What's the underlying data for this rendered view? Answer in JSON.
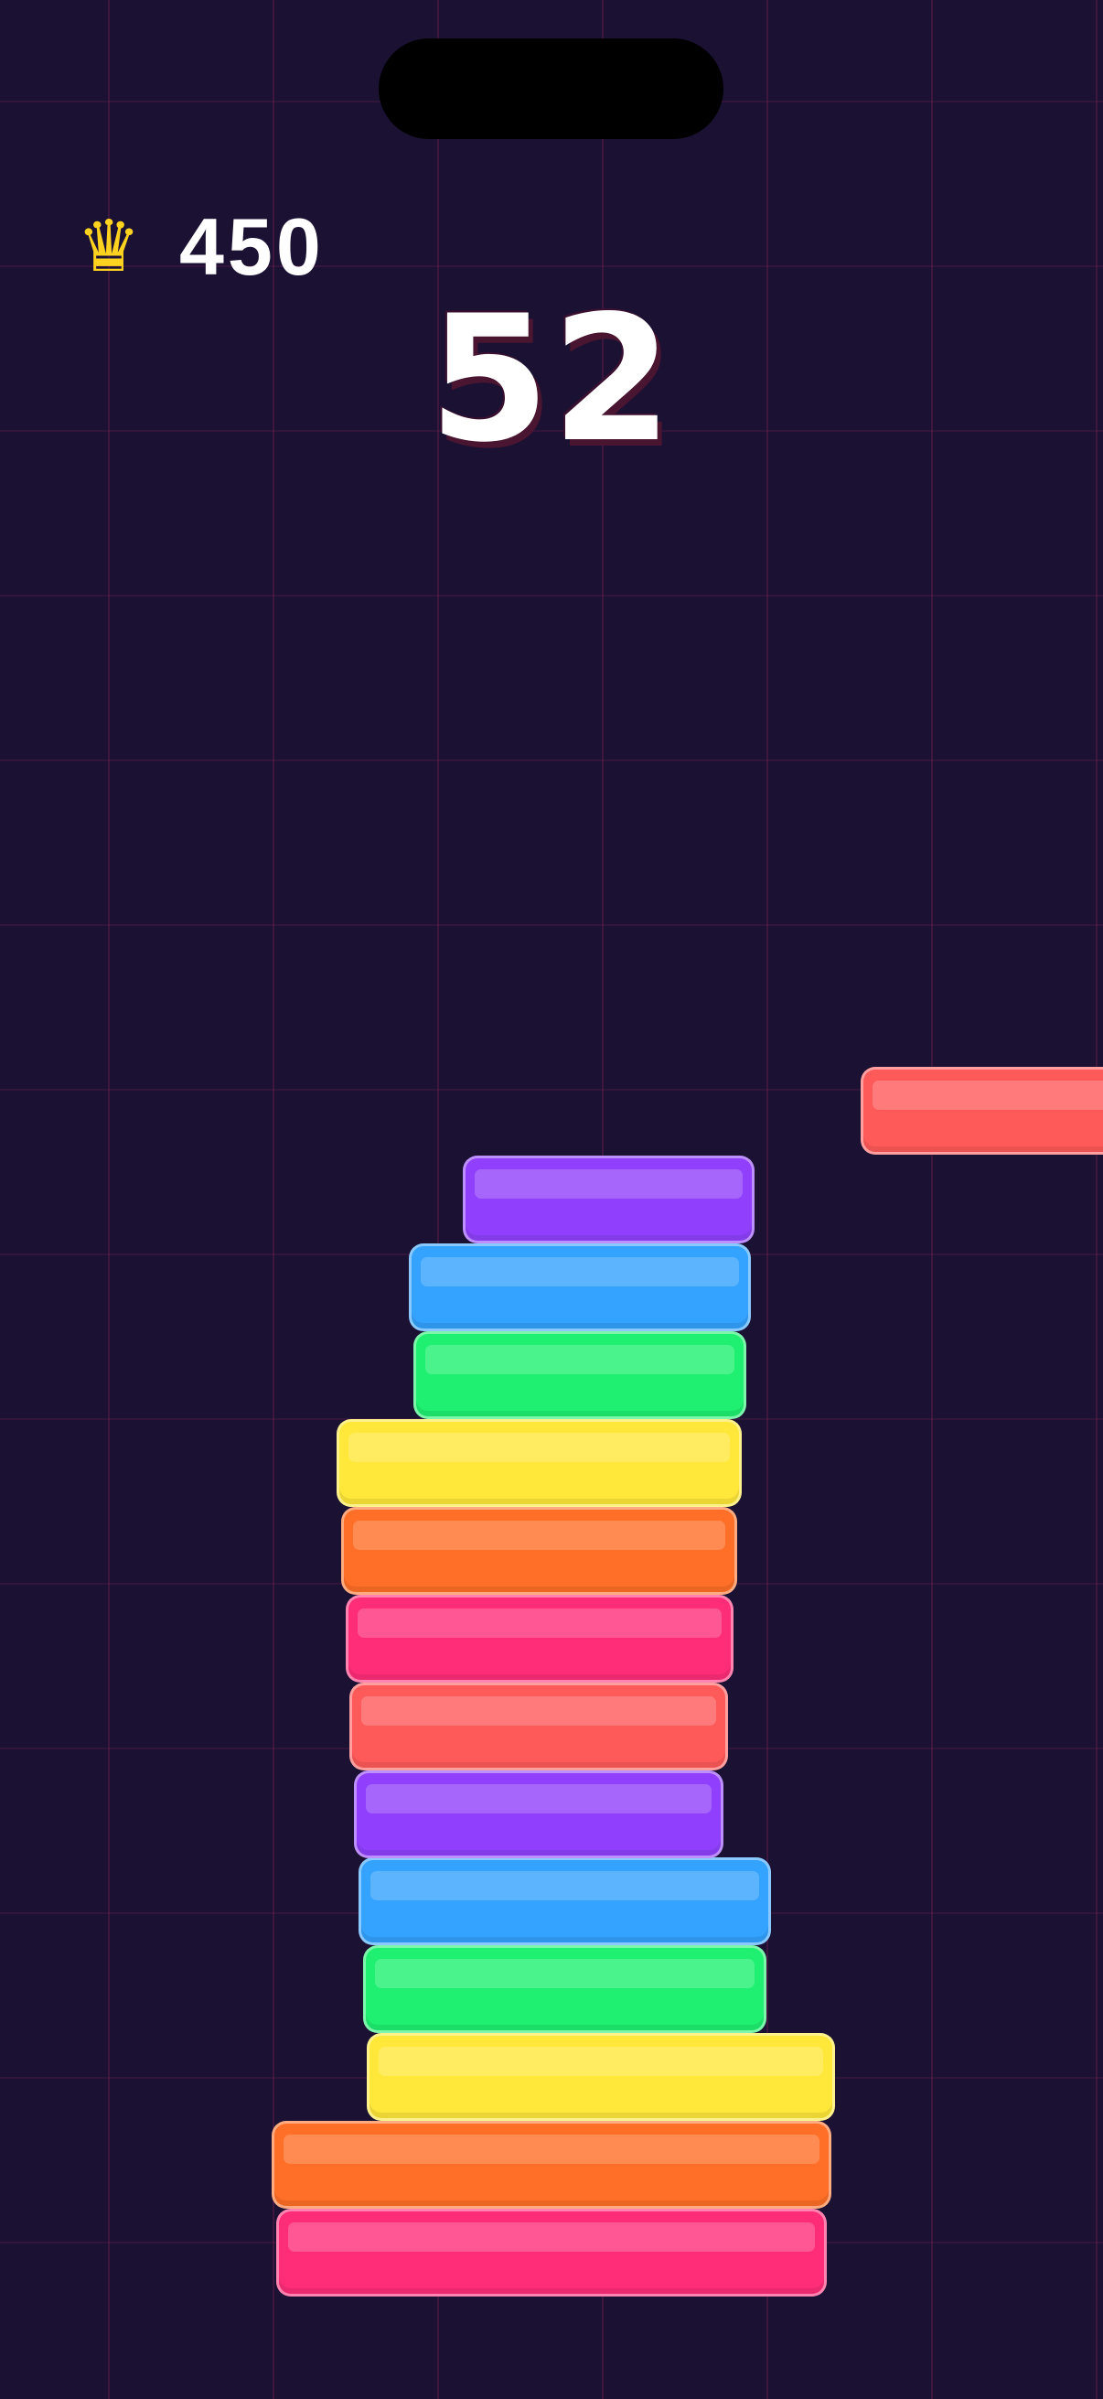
{
  "hud": {
    "best_icon": "crown-icon",
    "best_glyph": "♛",
    "best_score": "450",
    "current_score": "52"
  },
  "colors": {
    "background": "#1b1133",
    "grid_line": "#5a1e4a",
    "crown": "#ffd21f",
    "score_text": "#ffffff",
    "pink": "#ff2d78",
    "orange": "#ff6f27",
    "yellow": "#ffe83a",
    "green": "#1ff071",
    "blue": "#34a2ff",
    "purple": "#9040fc",
    "coral": "#ff5a5a"
  },
  "stack": {
    "order": "bottom-to-top",
    "block_colors": [
      "pink",
      "orange",
      "yellow",
      "green",
      "blue",
      "purple",
      "coral",
      "pink",
      "orange",
      "yellow",
      "green",
      "blue",
      "purple"
    ]
  },
  "moving_block": {
    "color": "coral"
  }
}
